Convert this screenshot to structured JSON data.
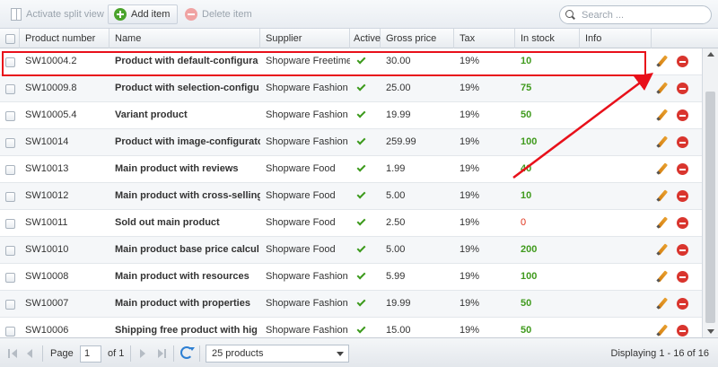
{
  "toolbar": {
    "split_view_label": "Activate split view",
    "add_label": "Add item",
    "delete_label": "Delete item",
    "search_placeholder": "Search ..."
  },
  "columns": {
    "number": "Product number",
    "name": "Name",
    "supplier": "Supplier",
    "active": "Active",
    "gross": "Gross price",
    "tax": "Tax",
    "stock": "In stock",
    "info": "Info"
  },
  "rows": [
    {
      "number": "SW10004.2",
      "name": "Product with default-configura",
      "supplier": "Shopware Freetime",
      "gross": "30.00",
      "tax": "19%",
      "stock": "10"
    },
    {
      "number": "SW10009.8",
      "name": "Product with selection-configu",
      "supplier": "Shopware Fashion",
      "gross": "25.00",
      "tax": "19%",
      "stock": "75"
    },
    {
      "number": "SW10005.4",
      "name": "Variant product",
      "supplier": "Shopware Fashion",
      "gross": "19.99",
      "tax": "19%",
      "stock": "50"
    },
    {
      "number": "SW10014",
      "name": "Product with image-configurator",
      "supplier": "Shopware Fashion",
      "gross": "259.99",
      "tax": "19%",
      "stock": "100"
    },
    {
      "number": "SW10013",
      "name": "Main product with reviews",
      "supplier": "Shopware Food",
      "gross": "1.99",
      "tax": "19%",
      "stock": "40"
    },
    {
      "number": "SW10012",
      "name": "Main product with cross-selling",
      "supplier": "Shopware Food",
      "gross": "5.00",
      "tax": "19%",
      "stock": "10"
    },
    {
      "number": "SW10011",
      "name": "Sold out main product",
      "supplier": "Shopware Food",
      "gross": "2.50",
      "tax": "19%",
      "stock": "0"
    },
    {
      "number": "SW10010",
      "name": "Main product base price calcul",
      "supplier": "Shopware Food",
      "gross": "5.00",
      "tax": "19%",
      "stock": "200"
    },
    {
      "number": "SW10008",
      "name": "Main product with resources",
      "supplier": "Shopware Fashion",
      "gross": "5.99",
      "tax": "19%",
      "stock": "100"
    },
    {
      "number": "SW10007",
      "name": "Main product with properties",
      "supplier": "Shopware Fashion",
      "gross": "19.99",
      "tax": "19%",
      "stock": "50"
    },
    {
      "number": "SW10006",
      "name": "Shipping free product with hig",
      "supplier": "Shopware Fashion",
      "gross": "15.00",
      "tax": "19%",
      "stock": "50"
    }
  ],
  "pager": {
    "page_label": "Page",
    "page_value": "1",
    "of_label": "of 1",
    "page_size": "25 products",
    "display_text": "Displaying 1 - 16 of 16"
  },
  "colors": {
    "accent_green": "#3f9a1c",
    "stock_zero": "#e0341c",
    "annotation_red": "#e8101a"
  }
}
